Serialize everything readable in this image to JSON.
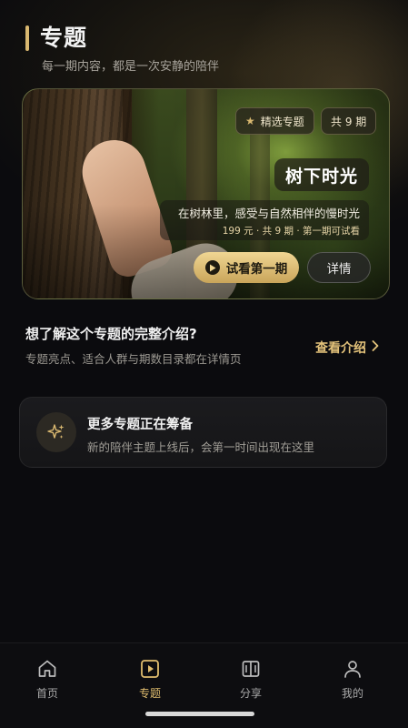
{
  "header": {
    "title": "专题",
    "subtitle": "每一期内容，都是一次安静的陪伴"
  },
  "featured_series": {
    "badge_featured": "精选专题",
    "badge_count": "共 9 期",
    "name": "树下时光",
    "description": "在树林里，感受与自然相伴的慢时光",
    "meta": "199 元 · 共 9 期 · 第一期可试看",
    "trial_button": "试看第一期",
    "detail_button": "详情"
  },
  "intro": {
    "title": "想了解这个专题的完整介绍?",
    "subtitle": "专题亮点、适合人群与期数目录都在详情页",
    "link": "查看介绍"
  },
  "coming_soon": {
    "title": "更多专题正在筹备",
    "subtitle": "新的陪伴主题上线后，会第一时间出现在这里"
  },
  "tabbar": {
    "items": [
      {
        "label": "首页",
        "icon": "home-icon",
        "active": false
      },
      {
        "label": "专题",
        "icon": "play-square-icon",
        "active": true
      },
      {
        "label": "分享",
        "icon": "book-open-icon",
        "active": false
      },
      {
        "label": "我的",
        "icon": "user-icon",
        "active": false
      }
    ]
  },
  "colors": {
    "accent_gold": "#e0bd6e",
    "background": "#0b0b0e"
  }
}
